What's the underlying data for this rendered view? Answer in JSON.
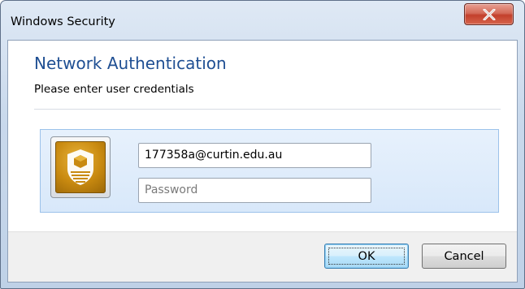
{
  "window": {
    "title": "Windows Security",
    "close_icon": "close-icon"
  },
  "dialog": {
    "heading": "Network Authentication",
    "subheading": "Please enter user credentials"
  },
  "credentials": {
    "tile_icon": "university-shield-icon",
    "username_value": "177358a@curtin.edu.au",
    "password_placeholder": "Password"
  },
  "buttons": {
    "ok_label": "OK",
    "cancel_label": "Cancel"
  },
  "colors": {
    "heading": "#1f4f93",
    "close_button": "#c2402c",
    "panel_background": "#d8e8fa",
    "tile": "#c98a10"
  }
}
